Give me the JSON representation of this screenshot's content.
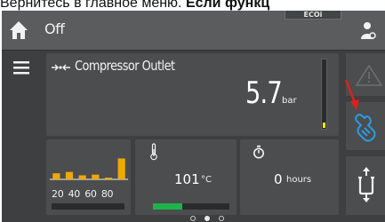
{
  "caption": {
    "prefix": "Вернитесь в главное меню.",
    "bold": " Если функц"
  },
  "header": {
    "title": "Off",
    "eco_label": "ECOi",
    "home_icon": "home-icon",
    "user_icon": "user-icon"
  },
  "compressor": {
    "label": "Compressor Outlet",
    "value": "5.7",
    "unit": "bar",
    "level_fraction": 0.08
  },
  "histogram": {
    "labels": [
      "20",
      "40",
      "60",
      "80"
    ],
    "bar_levels": [
      0.18,
      0.22,
      0.12,
      0.14,
      0.05,
      0.62
    ],
    "bar_color": "#f0a800"
  },
  "temperature": {
    "value": "101",
    "unit": "°C",
    "level_fraction": 0.38,
    "fill_color": "#1fb24a"
  },
  "hours": {
    "value": "0",
    "unit": "hours"
  },
  "side_buttons": {
    "alarm_icon": "warning-icon",
    "service_icon": "service-wrench-icon",
    "adjust_icon": "adjust-arrows-icon",
    "accent_color": "#2b9be0"
  },
  "pagination": {
    "count": 3,
    "active_index": 1
  }
}
